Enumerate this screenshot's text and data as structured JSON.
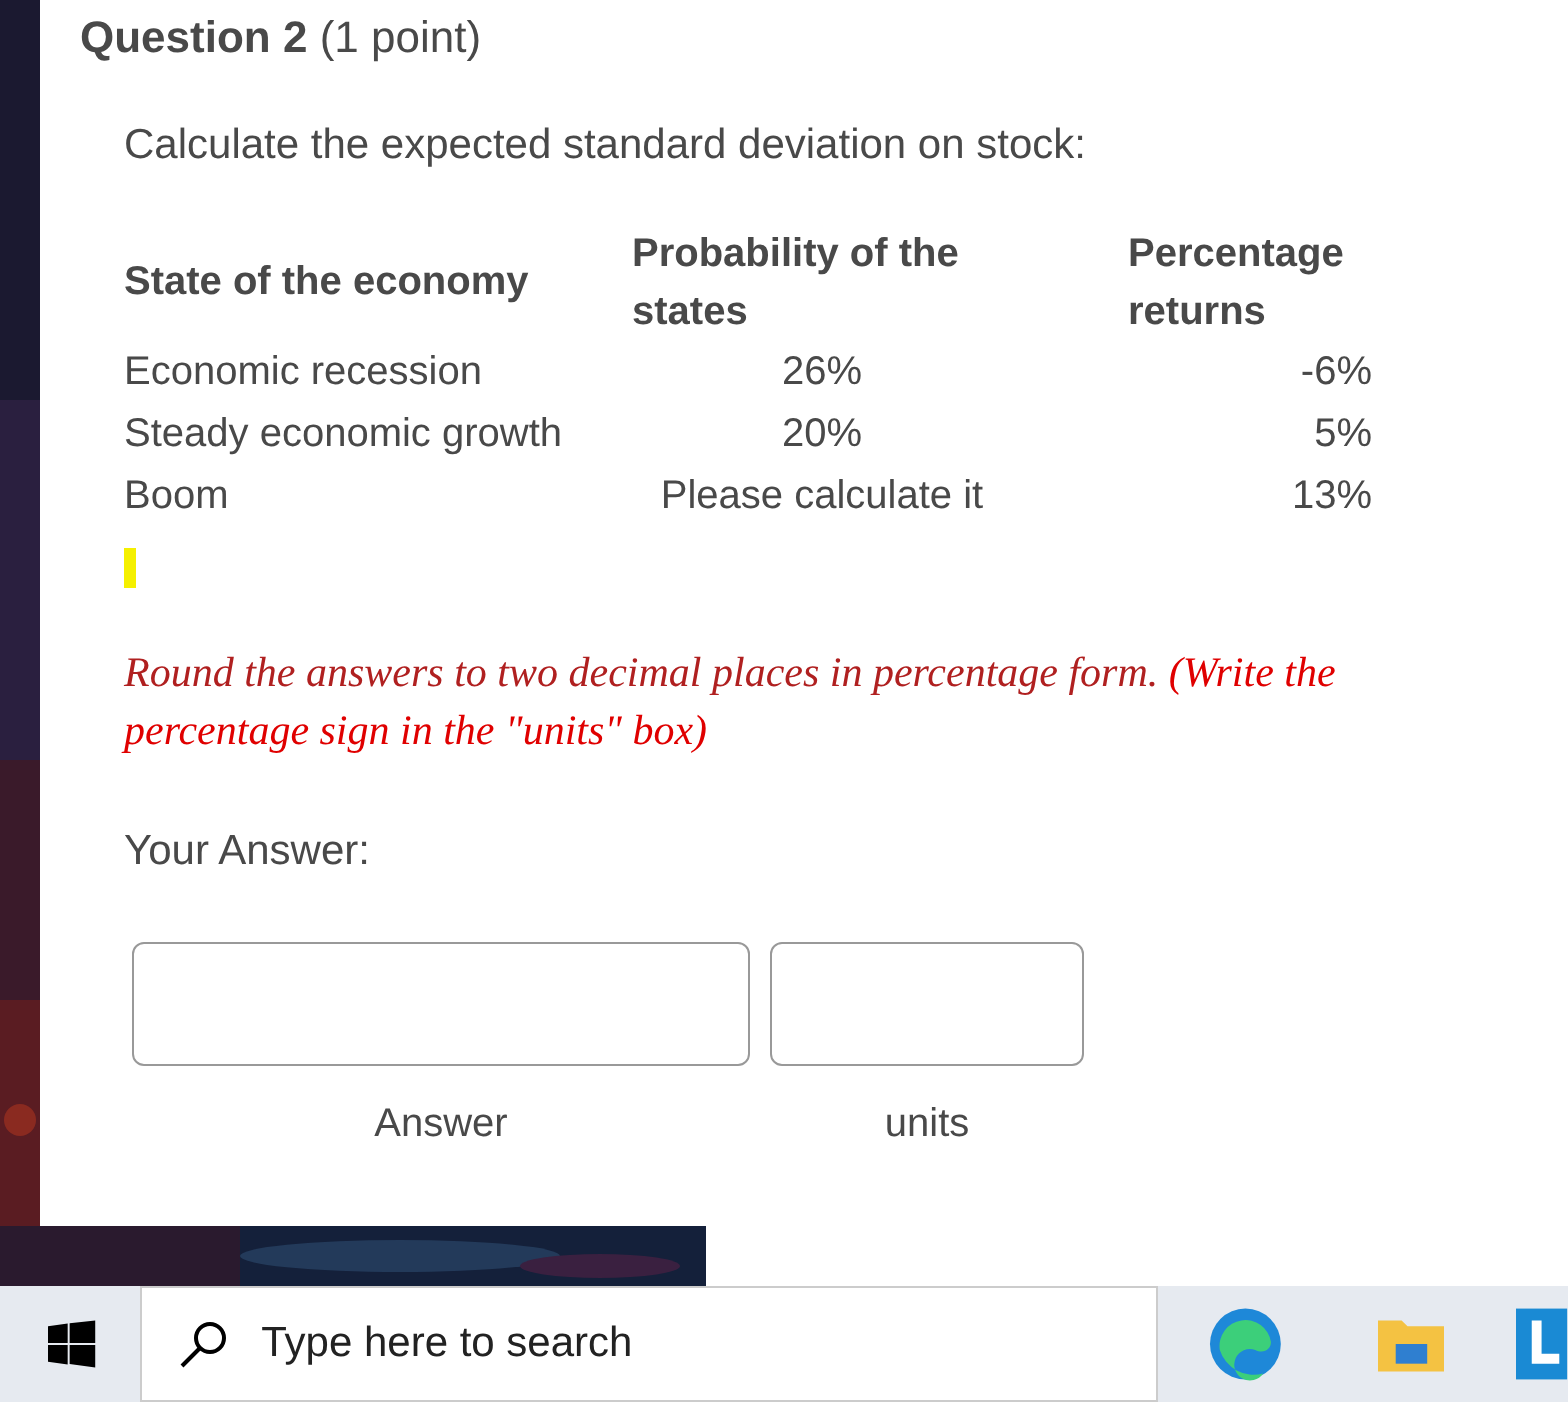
{
  "question": {
    "title": "Question 2",
    "points": "(1 point)",
    "prompt": "Calculate the expected standard deviation on stock:",
    "table": {
      "columns": [
        "State of the economy",
        "Probability of the states",
        "Percentage returns"
      ],
      "rows": [
        [
          "Economic recession",
          "26%",
          "-6%"
        ],
        [
          "Steady economic growth",
          "20%",
          "5%"
        ],
        [
          "Boom",
          "Please calculate it",
          "13%"
        ]
      ]
    },
    "instruction": "Round the answers to two decimal places in percentage form.",
    "instruction_note": "(Write the percentage sign in the \"units\" box)",
    "answer_label": "Your Answer:",
    "fields": [
      {
        "caption": "Answer"
      },
      {
        "caption": "units"
      }
    ]
  },
  "taskbar": {
    "search": {
      "placeholder": "Type here to search"
    }
  }
}
